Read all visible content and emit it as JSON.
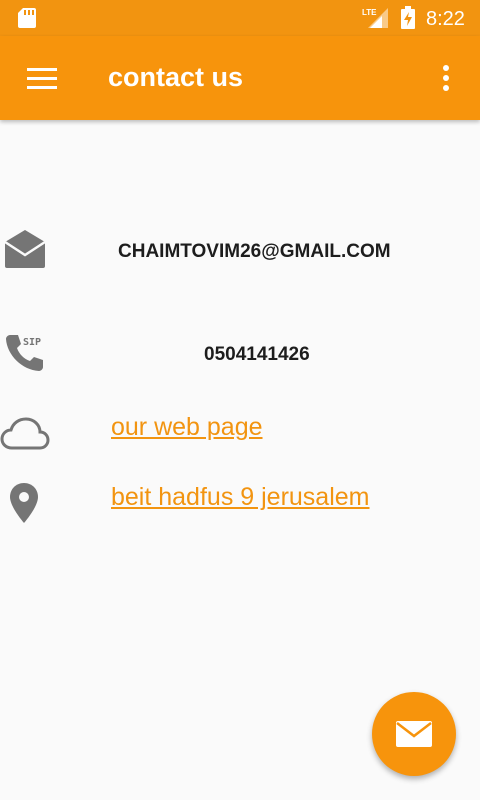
{
  "status_bar": {
    "time": "8:22",
    "network": "LTE",
    "icons": [
      "sd-card-icon",
      "lte-signal-icon",
      "battery-charging-icon"
    ]
  },
  "app_bar": {
    "title": "contact us",
    "icons": [
      "menu-icon",
      "overflow-menu-icon"
    ]
  },
  "contacts": {
    "email": "CHAIMTOVIM26@GMAIL.COM",
    "phone": "0504141426",
    "website_link": "our web page",
    "address_link": "beit hadfus 9 jerusalem"
  },
  "fab": {
    "icon": "mail-icon"
  },
  "colors": {
    "primary": "#f7940c",
    "status_bar": "#f29410",
    "link": "#f29410",
    "icon_gray": "#757575",
    "background": "#fafafa"
  }
}
